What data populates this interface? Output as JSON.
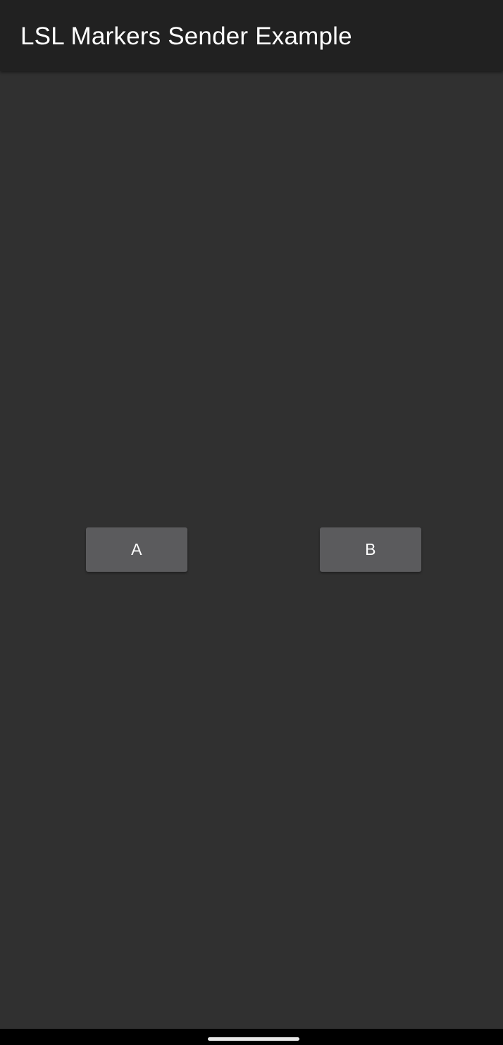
{
  "app_bar": {
    "title": "LSL Markers Sender Example"
  },
  "buttons": {
    "a_label": "A",
    "b_label": "B"
  },
  "colors": {
    "app_bar": "#212121",
    "background": "#303030",
    "button": "#5b5b5d",
    "text": "#ffffff",
    "nav_bar": "#000000"
  },
  "icons": {
    "home_handle": "home-gesture-handle"
  }
}
